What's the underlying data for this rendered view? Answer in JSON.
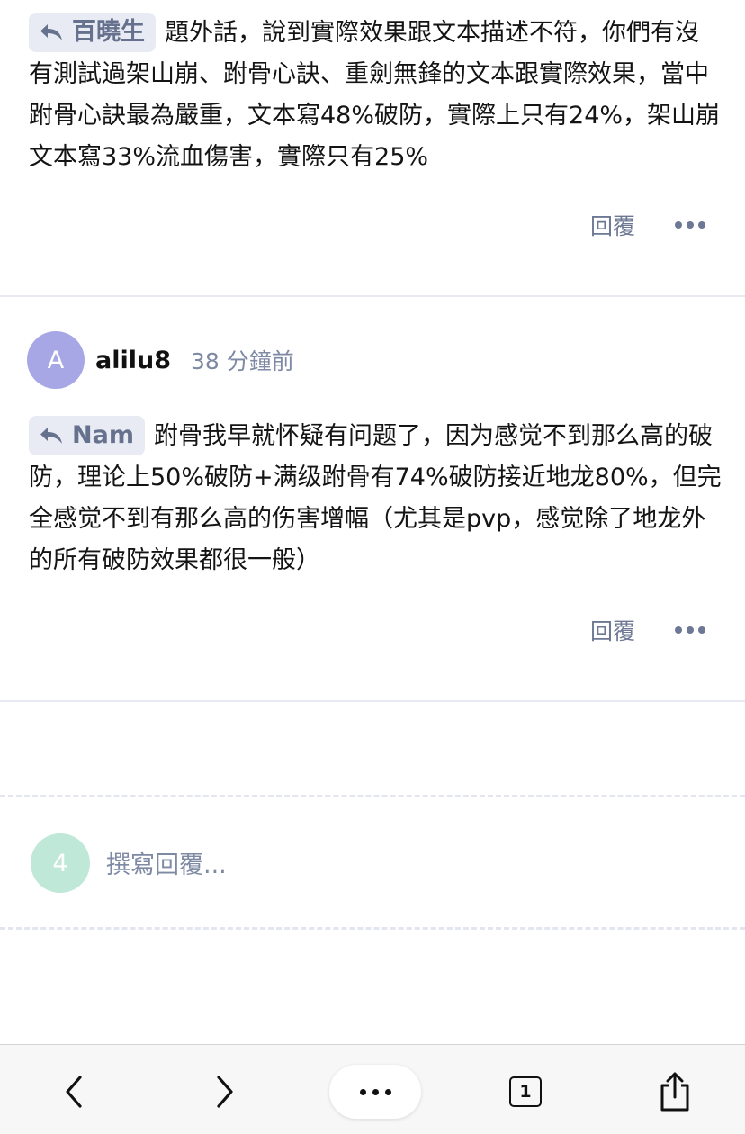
{
  "posts": [
    {
      "mention": "百曉生",
      "text": "題外話，說到實際效果跟文本描述不符，你們有沒有測試過架山崩、跗骨心訣、重劍無鋒的文本跟實際效果，當中跗骨心訣最為嚴重，文本寫48%破防，實際上只有24%，架山崩文本寫33%流血傷害，實際只有25%",
      "reply_label": "回覆"
    },
    {
      "author": {
        "initial": "A",
        "name": "alilu8",
        "time": "38 分鐘前",
        "avatar_color": "#a7a7e6"
      },
      "mention": "Nam",
      "text": "跗骨我早就怀疑有问题了，因为感觉不到那么高的破防，理论上50%破防+满级跗骨有74%破防接近地龙80%，但完全感觉不到有那么高的伤害增幅（尤其是pvp，感觉除了地龙外的所有破防效果都很一般）",
      "reply_label": "回覆"
    }
  ],
  "composer": {
    "avatar_initial": "4",
    "avatar_color": "#bfe8d8",
    "placeholder": "撰寫回覆..."
  },
  "toolbar": {
    "tab_count": "1",
    "items": [
      "chevron-left-icon",
      "chevron-right-icon",
      "more-icon",
      "tabs-icon",
      "share-icon"
    ]
  },
  "colors": {
    "mention_bg": "#e8ebf4",
    "mention_text": "#66728d",
    "muted_text": "#7e89a4",
    "divider": "#e7e9f3"
  }
}
